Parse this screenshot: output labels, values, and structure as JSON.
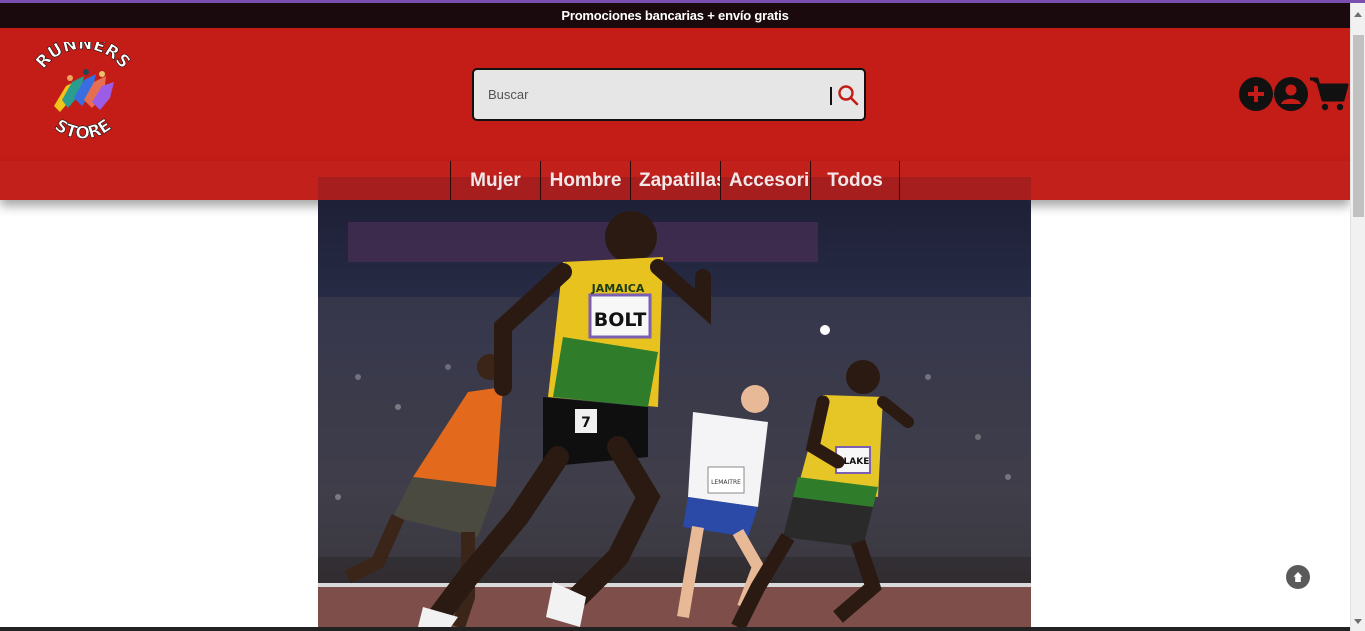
{
  "promo": {
    "text": "Promociones bancarias + envío gratis"
  },
  "logo": {
    "line1": "RUNNERS",
    "line2": "STORE"
  },
  "search": {
    "placeholder": "Buscar",
    "value": ""
  },
  "header_icons": [
    "add-icon",
    "user-icon",
    "cart-icon"
  ],
  "nav": {
    "items": [
      {
        "label": "Mujer"
      },
      {
        "label": "Hombre"
      },
      {
        "label": "Zapatillas"
      },
      {
        "label": "Accesorios"
      },
      {
        "label": "Todos"
      }
    ]
  },
  "hero": {
    "bib_main": "BOLT",
    "bib_right": "BLAKE",
    "bib_center": "LEMAITRE",
    "shirt_main": "JAMAICA",
    "lane_main": "7"
  },
  "colors": {
    "brand_red": "#c41c17",
    "promo_bg": "#1a0a0e",
    "search_bg": "#e6e6e6"
  }
}
